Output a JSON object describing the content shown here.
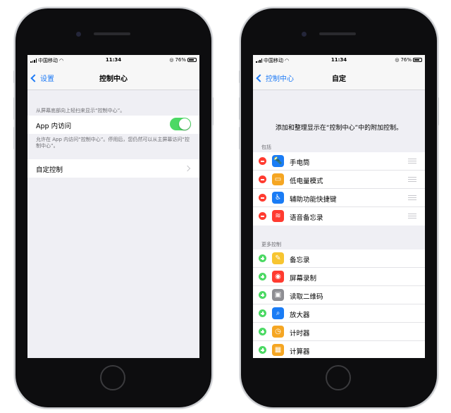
{
  "left_screen": {
    "status": {
      "carrier": "中国移动",
      "time": "11:34",
      "battery": "76%"
    },
    "nav": {
      "back": "设置",
      "title": "控制中心"
    },
    "description": "从屏幕底部向上轻扫来显示“控制中心”。",
    "access": {
      "label": "App 内访问",
      "on": true
    },
    "access_description": "允许在 App 内访问“控制中心”。停用后，您仍然可以从主屏幕访问“控制中心”。",
    "customize_label": "自定控制"
  },
  "right_screen": {
    "status": {
      "carrier": "中国移动",
      "time": "11:34",
      "battery": "76%"
    },
    "nav": {
      "back": "控制中心",
      "title": "自定"
    },
    "intro": "添加和整理显示在“控制中心”中的附加控制。",
    "include_header": "包括",
    "included": [
      {
        "label": "手电筒",
        "icon": "flashlight-icon",
        "color": "#1a7cf5"
      },
      {
        "label": "低电量模式",
        "icon": "battery-icon",
        "color": "#f5a623"
      },
      {
        "label": "辅助功能快捷键",
        "icon": "accessibility-icon",
        "color": "#1a7cf5"
      },
      {
        "label": "语音备忘录",
        "icon": "waveform-icon",
        "color": "#ff3b30"
      }
    ],
    "more_header": "更多控制",
    "more": [
      {
        "label": "备忘录",
        "icon": "notes-icon",
        "color": "#f7c531"
      },
      {
        "label": "屏幕录制",
        "icon": "record-icon",
        "color": "#ff3b30"
      },
      {
        "label": "读取二维码",
        "icon": "qrcode-icon",
        "color": "#8e8e93"
      },
      {
        "label": "放大器",
        "icon": "magnifier-icon",
        "color": "#1a7cf5"
      },
      {
        "label": "计时器",
        "icon": "timer-icon",
        "color": "#f5a623"
      },
      {
        "label": "计算器",
        "icon": "calculator-icon",
        "color": "#f5a623"
      }
    ]
  }
}
